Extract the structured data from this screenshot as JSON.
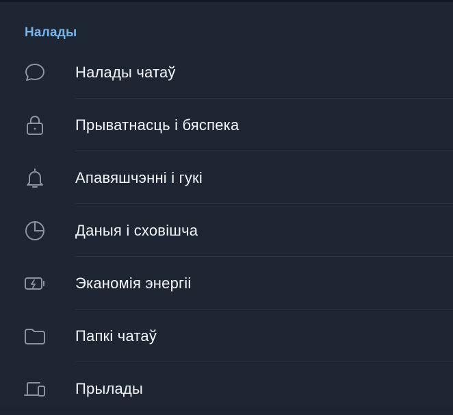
{
  "section": {
    "title": "Налады"
  },
  "menu": {
    "items": [
      {
        "label": "Налады чатаў",
        "icon": "chat-bubble-icon"
      },
      {
        "label": "Прыватнасць і бяспека",
        "icon": "lock-icon"
      },
      {
        "label": "Апавяшчэнні і гукі",
        "icon": "bell-icon"
      },
      {
        "label": "Даныя і сховішча",
        "icon": "pie-chart-icon"
      },
      {
        "label": "Эканомія энергіі",
        "icon": "battery-bolt-icon"
      },
      {
        "label": "Папкі чатаў",
        "icon": "folder-icon"
      },
      {
        "label": "Прылады",
        "icon": "devices-icon"
      }
    ]
  },
  "colors": {
    "background": "#1e2533",
    "accent": "#73b7ee",
    "text": "#f4f6f9",
    "icon": "#8d95a3",
    "separator": "#2d3544"
  }
}
